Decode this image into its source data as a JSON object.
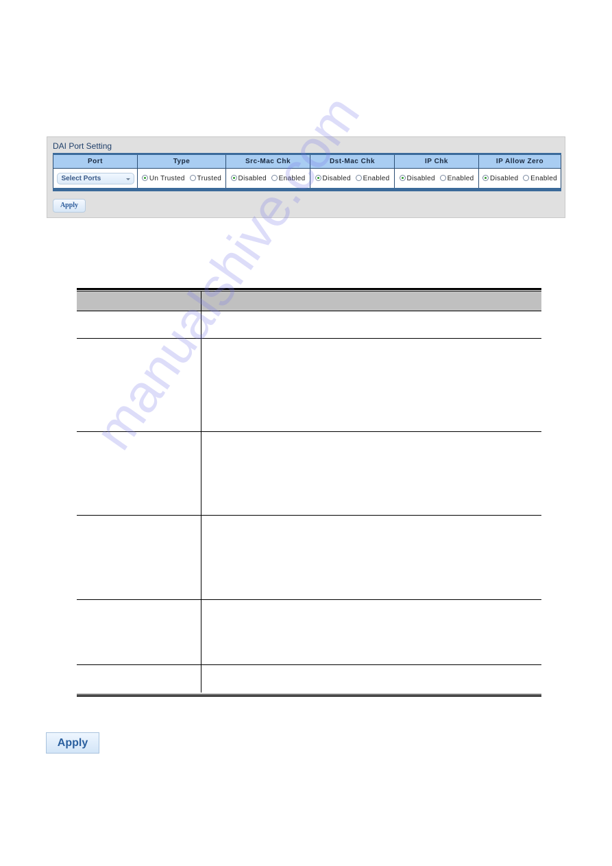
{
  "panel": {
    "title": "DAI Port Setting",
    "columns": [
      "Port",
      "Type",
      "Src-Mac Chk",
      "Dst-Mac Chk",
      "IP Chk",
      "IP Allow Zero"
    ],
    "port_select": {
      "value": "Select Ports",
      "icon": "chevron-down-icon"
    },
    "type": {
      "options": [
        "Un Trusted",
        "Trusted"
      ],
      "selected": "Un Trusted"
    },
    "src_mac_chk": {
      "options": [
        "Disabled",
        "Enabled"
      ],
      "selected": "Disabled"
    },
    "dst_mac_chk": {
      "options": [
        "Disabled",
        "Enabled"
      ],
      "selected": "Disabled"
    },
    "ip_chk": {
      "options": [
        "Disabled",
        "Enabled"
      ],
      "selected": "Disabled"
    },
    "ip_allow_zero": {
      "options": [
        "Disabled",
        "Enabled"
      ],
      "selected": "Disabled"
    },
    "apply_label": "Apply",
    "selected_color": "#2e9a2e",
    "header_color": "#a9cdf2",
    "border_color": "#3b6a9a"
  },
  "description_table": {
    "header": [
      "",
      ""
    ],
    "rows": [
      [
        "",
        ""
      ],
      [
        "",
        ""
      ],
      [
        "",
        ""
      ],
      [
        "",
        ""
      ],
      [
        "",
        ""
      ],
      [
        "",
        ""
      ]
    ]
  },
  "apply_button": {
    "label": "Apply"
  },
  "watermark": "manualshive.com"
}
